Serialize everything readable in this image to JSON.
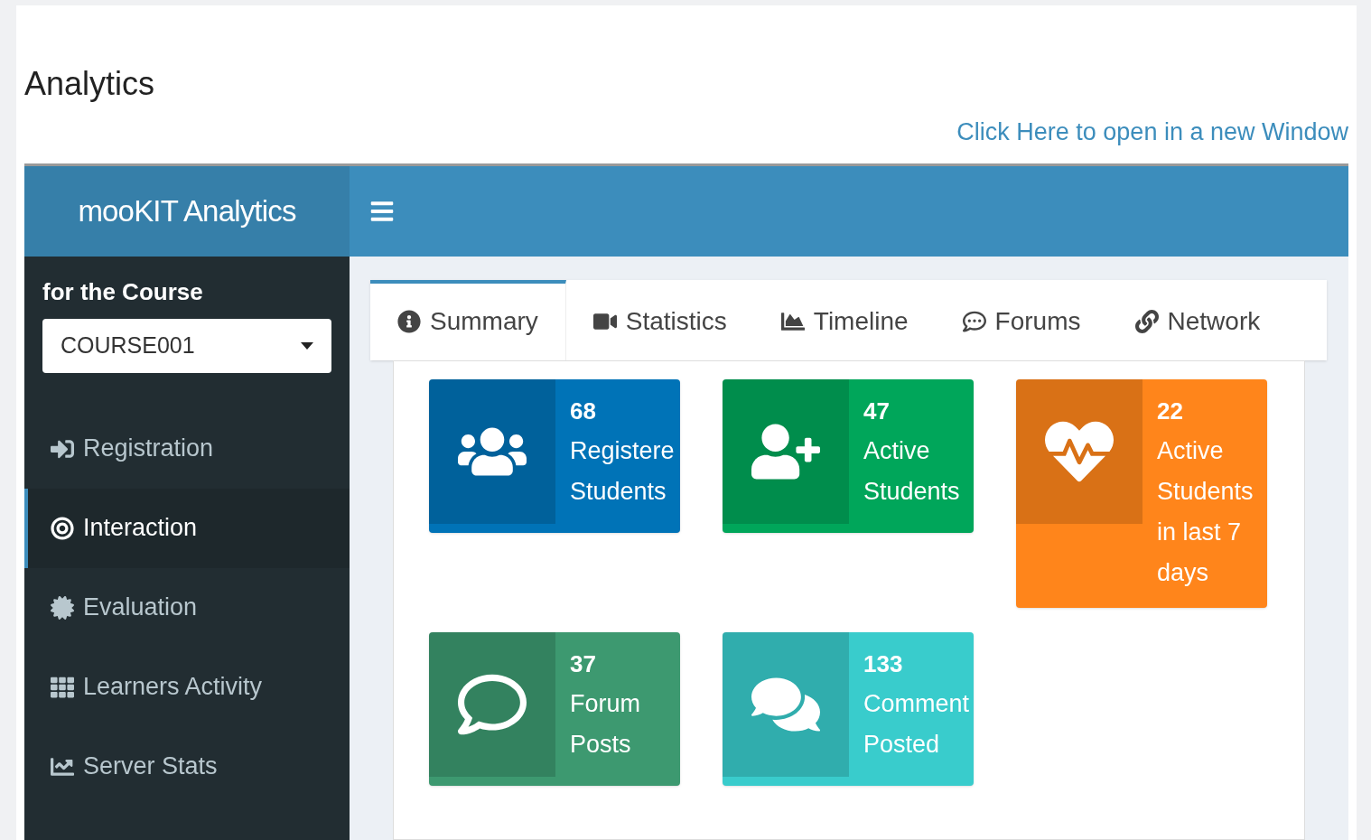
{
  "page": {
    "title": "Analytics",
    "link": "Click Here to open in a new Window"
  },
  "app": {
    "brand": "mooKIT Analytics"
  },
  "sidebar": {
    "heading": "for the Course",
    "course_select": {
      "value": "COURSE001"
    },
    "items": [
      {
        "label": "Registration",
        "kind": "signin",
        "selected": false
      },
      {
        "label": "Interaction",
        "kind": "target",
        "selected": true
      },
      {
        "label": "Evaluation",
        "kind": "badge",
        "selected": false
      },
      {
        "label": "Learners Activity",
        "kind": "grid",
        "selected": false
      },
      {
        "label": "Server Stats",
        "kind": "chart",
        "selected": false
      }
    ]
  },
  "tabs": [
    {
      "label": "Summary",
      "kind": "info",
      "selected": true
    },
    {
      "label": "Statistics",
      "kind": "video",
      "selected": false
    },
    {
      "label": "Timeline",
      "kind": "area",
      "selected": false
    },
    {
      "label": "Forums",
      "kind": "comment",
      "selected": false
    },
    {
      "label": "Network",
      "kind": "link",
      "selected": false
    }
  ],
  "info_boxes": [
    {
      "number": "68",
      "label": "Registere Students",
      "kind": "users",
      "color": "#0073b7"
    },
    {
      "number": "47",
      "label": "Active Students",
      "kind": "userplus",
      "color": "#00a65a"
    },
    {
      "number": "22",
      "label": "Active Students in last 7 days",
      "kind": "heartbeat",
      "color": "#ff851b"
    },
    {
      "number": "37",
      "label": "Forum Posts",
      "kind": "bubble",
      "color": "#3d9970"
    },
    {
      "number": "133",
      "label": "Comment Posted",
      "kind": "bubbles",
      "color": "#39cccc"
    }
  ]
}
